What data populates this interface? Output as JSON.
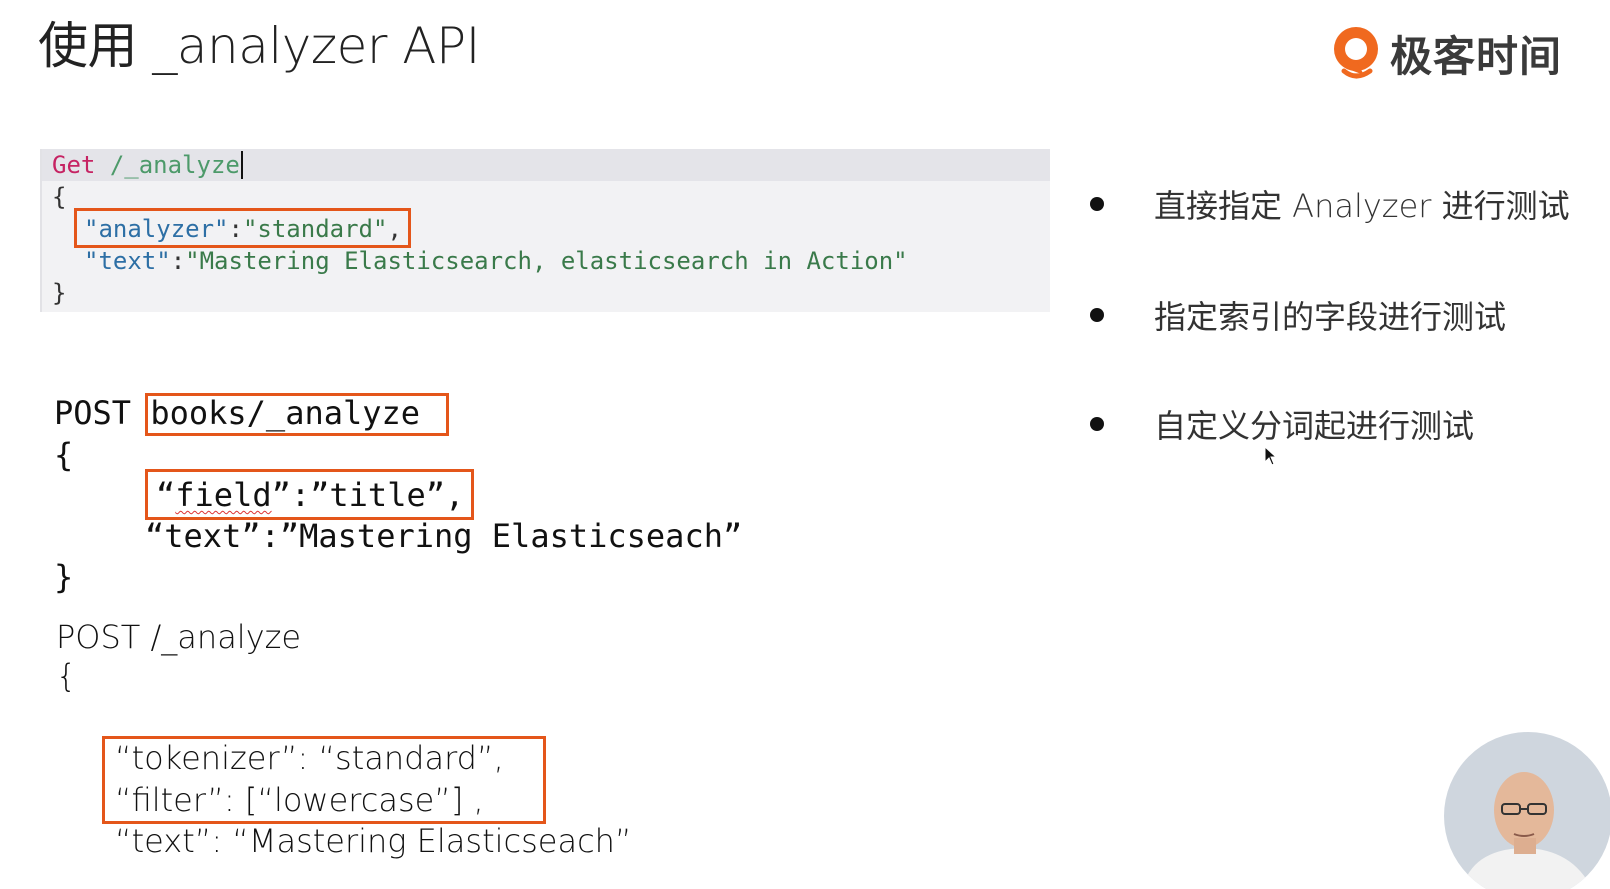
{
  "slide": {
    "title": "使用 _analyzer API"
  },
  "logo": {
    "text": "极客时间",
    "accent_color": "#f0691f"
  },
  "console": {
    "method": "Get",
    "path": "/_analyze",
    "open_brace": "{",
    "line1_key": "\"analyzer\"",
    "line1_colon": ":",
    "line1_value": "\"standard\"",
    "line1_comma": ",",
    "line2_key": "\"text\"",
    "line2_colon": ":",
    "line2_value": "\"Mastering Elasticsearch, elasticsearch in Action\"",
    "close_brace": "}"
  },
  "example2": {
    "method": "POST",
    "path": "books/_analyze",
    "open_brace": "{",
    "field_prefix": "“",
    "field_word": "field",
    "field_rest": "”:”title”,",
    "text_line": "“text”:”Mastering Elasticseach”",
    "close_brace": "}"
  },
  "example3": {
    "request_line": "POST /_analyze",
    "open_brace": "{",
    "tokenizer_line": "“tokenizer”: “standard”,",
    "filter_line": "“filter”: [“lowercase”] ,",
    "text_line": "“text”: “Mastering Elasticseach”"
  },
  "bullets": [
    {
      "text": "直接指定 Analyzer 进行测试"
    },
    {
      "text": "指定索引的字段进行测试"
    },
    {
      "text": "自定义分词起进行测试"
    }
  ],
  "colors": {
    "highlight_border": "#e4561a",
    "console_bg": "#f2f2f4",
    "method_color": "#c62363",
    "key_color": "#2d6fa5",
    "string_color": "#3a7a4a"
  }
}
